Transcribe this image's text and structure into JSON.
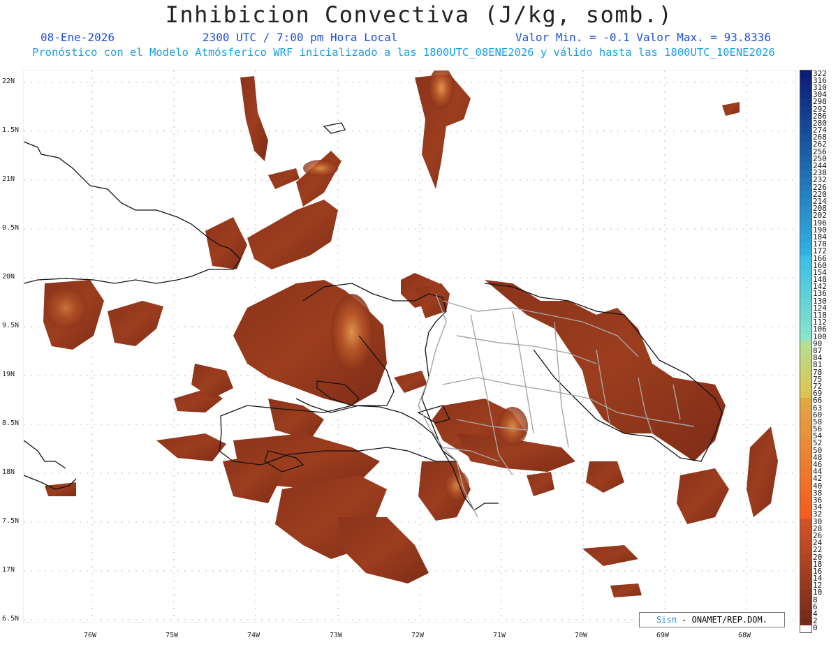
{
  "title": "Inhibicion Convectiva (J/kg, somb.)",
  "header": {
    "date": "08-Ene-2026",
    "time": "2300 UTC / 7:00 pm Hora Local",
    "minmax": "Valor Min. = -0.1  Valor Max. = 93.8336",
    "forecast_line": "Pronóstico con el Modelo Atmósferico WRF inicializado a las 1800UTC_08ENE2026 y válido hasta las  1800UTC_10ENE2026"
  },
  "axes": {
    "lat_labels": [
      "22N",
      "1.5N",
      "21N",
      "0.5N",
      "20N",
      "9.5N",
      "19N",
      "8.5N",
      "18N",
      "7.5N",
      "17N",
      "6.5N"
    ],
    "lon_labels": [
      "76W",
      "75W",
      "74W",
      "73W",
      "72W",
      "71W",
      "70W",
      "69W",
      "68W"
    ]
  },
  "colorbar": {
    "labels": [
      "322",
      "316",
      "310",
      "304",
      "298",
      "292",
      "286",
      "280",
      "274",
      "268",
      "262",
      "256",
      "250",
      "244",
      "238",
      "232",
      "226",
      "220",
      "214",
      "208",
      "202",
      "196",
      "190",
      "184",
      "178",
      "172",
      "166",
      "160",
      "154",
      "148",
      "142",
      "136",
      "130",
      "124",
      "118",
      "112",
      "106",
      "100",
      "90",
      "87",
      "84",
      "81",
      "78",
      "75",
      "72",
      "69",
      "66",
      "63",
      "60",
      "58",
      "56",
      "54",
      "52",
      "50",
      "48",
      "46",
      "44",
      "42",
      "40",
      "38",
      "36",
      "34",
      "32",
      "30",
      "28",
      "26",
      "24",
      "22",
      "20",
      "18",
      "16",
      "14",
      "12",
      "10",
      "8",
      "6",
      "4",
      "2",
      "0"
    ]
  },
  "credit": {
    "brand": "Sisπ",
    "text": " - ONAMET/REP.DOM."
  },
  "colors": {
    "field_dark": "#7a2a18",
    "field_mid": "#a0401e",
    "field_hot": "#e8a050",
    "coast": "#111111",
    "borders": "#a6a6a6",
    "title_blue": "#1f4fd8",
    "subtitle_cyan": "#17a0e6"
  }
}
